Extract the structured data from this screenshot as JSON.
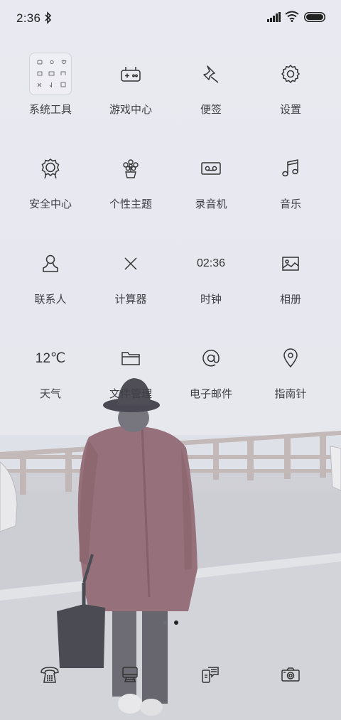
{
  "status_bar": {
    "time": "2:36"
  },
  "apps": [
    {
      "label": "系统工具",
      "icon": "folder-icon"
    },
    {
      "label": "游戏中心",
      "icon": "gamepad-icon"
    },
    {
      "label": "便签",
      "icon": "pin-icon"
    },
    {
      "label": "设置",
      "icon": "gear-icon"
    },
    {
      "label": "安全中心",
      "icon": "shield-badge-icon"
    },
    {
      "label": "个性主题",
      "icon": "flower-pot-icon"
    },
    {
      "label": "录音机",
      "icon": "cassette-icon"
    },
    {
      "label": "音乐",
      "icon": "music-note-icon"
    },
    {
      "label": "联系人",
      "icon": "contact-icon"
    },
    {
      "label": "计算器",
      "icon": "calculator-icon"
    },
    {
      "label": "时钟",
      "icon": "clock-icon"
    },
    {
      "label": "相册",
      "icon": "gallery-icon"
    },
    {
      "label": "天气",
      "icon": "weather-icon"
    },
    {
      "label": "文件管理",
      "icon": "folder-outline-icon"
    },
    {
      "label": "电子邮件",
      "icon": "at-sign-icon"
    },
    {
      "label": "指南针",
      "icon": "location-pin-icon"
    }
  ],
  "clock_icon_text": "02:36",
  "weather_icon_text": "12℃",
  "page_indicator": {
    "pages": 2,
    "current": 2
  },
  "dock": [
    {
      "icon": "phone-icon"
    },
    {
      "icon": "browser-icon"
    },
    {
      "icon": "messages-icon"
    },
    {
      "icon": "camera-icon"
    }
  ],
  "colors": {
    "background": "#e8e9ef",
    "text": "#3e3e44",
    "icon_stroke": "#333333"
  }
}
